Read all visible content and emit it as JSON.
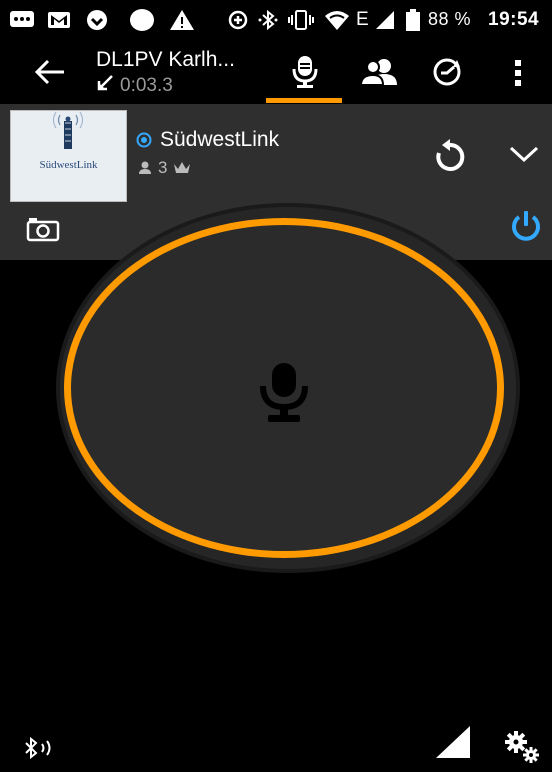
{
  "status_bar": {
    "battery": "88 %",
    "time": "19:54",
    "network": "E"
  },
  "header": {
    "title": "DL1PV Karlh...",
    "elapsed": "0:03.3",
    "tabs": [
      "microphone",
      "contacts",
      "history"
    ],
    "active_tab": "microphone"
  },
  "channel": {
    "name": "SüdwestLink",
    "user_count": "3",
    "logo_text": "SüdwestLink"
  },
  "colors": {
    "accent": "#ff9a00",
    "power": "#33aaff",
    "panel": "#2f2f2f"
  }
}
